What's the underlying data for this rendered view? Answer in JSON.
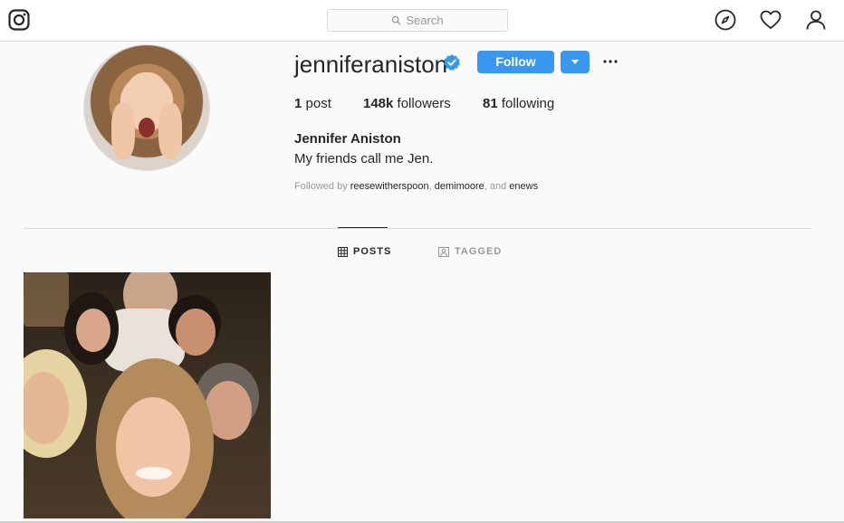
{
  "nav": {
    "search_placeholder": "Search"
  },
  "profile": {
    "username": "jenniferaniston",
    "follow_label": "Follow",
    "stats": {
      "posts_count": "1",
      "posts_label": "post",
      "followers_count": "148k",
      "followers_label": "followers",
      "following_count": "81",
      "following_label": "following"
    },
    "full_name": "Jennifer Aniston",
    "bio": "My friends call me Jen.",
    "followed_by": {
      "prefix": "Followed by",
      "accounts": [
        "reesewitherspoon",
        "demimoore",
        "enews"
      ],
      "sep": ",",
      "and": ", and"
    }
  },
  "tabs": {
    "posts": "POSTS",
    "tagged": "TAGGED"
  },
  "colors": {
    "accent": "#3897f0",
    "text": "#262626",
    "muted": "#999999",
    "border": "#dbdbdb"
  },
  "icons": [
    "instagram-logo-icon",
    "search-icon",
    "compass-icon",
    "heart-icon",
    "user-icon",
    "verified-badge-icon",
    "chevron-down-icon",
    "more-icon",
    "grid-icon",
    "tag-icon"
  ]
}
